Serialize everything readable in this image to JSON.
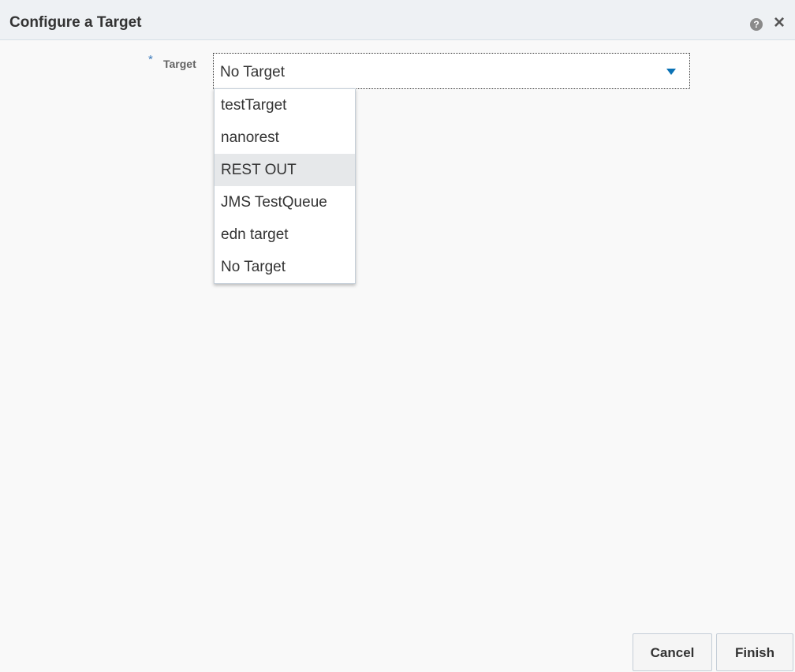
{
  "dialog": {
    "title": "Configure a Target",
    "help_icon": "question-circle-icon",
    "close_icon": "close-icon"
  },
  "form": {
    "required_mark": "*",
    "target_label": "Target",
    "target_value": "No Target",
    "dropdown_icon": "caret-down-icon",
    "options": [
      "testTarget",
      "nanorest",
      "REST OUT",
      "JMS TestQueue",
      "edn target",
      "No Target"
    ],
    "highlighted_option": "REST OUT"
  },
  "buttons": {
    "cancel": "Cancel",
    "finish": "Finish"
  },
  "colors": {
    "accent": "#0b72b5",
    "required": "#3c7abb",
    "highlight": "#e6e8ea"
  }
}
